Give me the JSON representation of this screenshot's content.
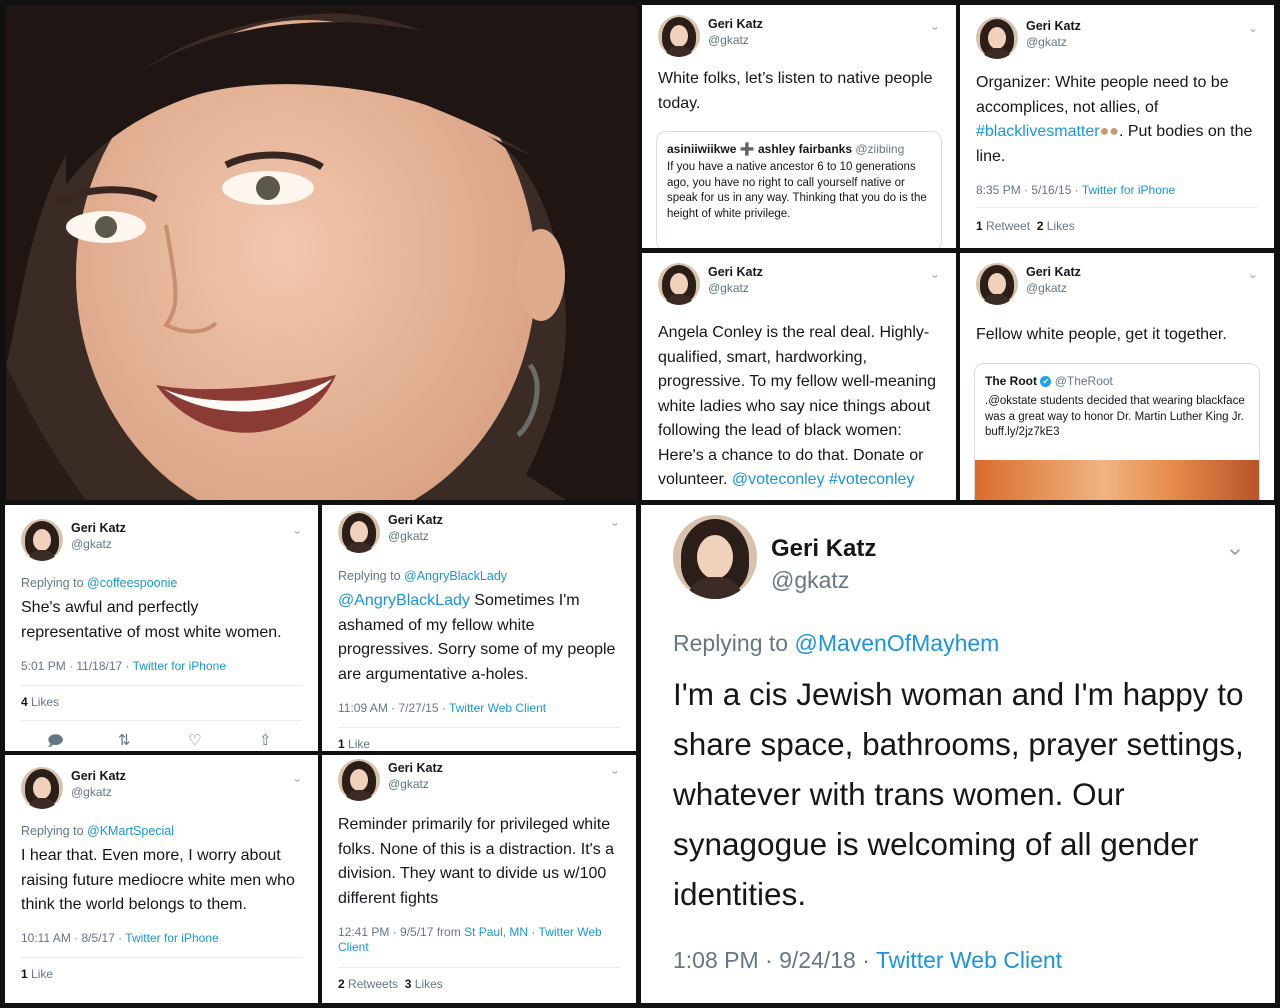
{
  "colors": {
    "link": "#1b95e0",
    "secondary": "#657786",
    "text": "#14171a",
    "background": "#111111"
  },
  "profile": {
    "name": "Geri Katz",
    "handle": "@gkatz"
  },
  "icons": {
    "menu": "chevron-down-icon",
    "reply": "reply-icon",
    "retweet": "retweet-icon",
    "like": "heart-icon",
    "share": "share-icon"
  },
  "tweets": [
    {
      "text": "White folks, let’s listen to native people today.",
      "quote": {
        "author": "asiniiwiikwe ➕ ashley fairbanks",
        "handle": "@ziibiing",
        "text": "If you have a native ancestor 6 to 10 generations ago, you have no right to call yourself native or speak for us in any way. Thinking that you do is the height of white privilege."
      }
    },
    {
      "text_main": "Organizer: White people need to be accomplices, not allies, of ",
      "hashtag": "#blacklivesmatter",
      "text_after": ". Put bodies on the line.",
      "time": "8:35 PM · 5/16/15 · ",
      "client": "Twitter for iPhone",
      "retweets": "1",
      "retweets_label": "Retweet",
      "likes": "2",
      "likes_label": "Likes"
    },
    {
      "text_main": "Angela Conley is the real deal. Highly-qualified, smart, hardworking, progressive. To my fellow well-meaning white ladies who say nice things about following the lead of black women: Here's a chance to do that. Donate or volunteer. ",
      "mention": "@voteconley",
      "hashtag": "#voteconley"
    },
    {
      "text": "Fellow white people, get it together.",
      "quote": {
        "author": "The Root",
        "verified": "✔",
        "handle": "@TheRoot",
        "text": ".@okstate students decided that wearing blackface was a great way to honor Dr. Martin Luther King Jr. buff.ly/2jz7kE3"
      }
    },
    {
      "replying_label": "Replying to ",
      "replying_to": "@coffeespoonie",
      "text": "She's awful and perfectly representative of most white women.",
      "time": "5:01 PM · 11/18/17 · ",
      "client": "Twitter for iPhone",
      "likes": "4",
      "likes_label": "Likes"
    },
    {
      "replying_label": "Replying to ",
      "replying_to": "@AngryBlackLady",
      "mention": "@AngryBlackLady",
      "text_main": " Sometimes I'm ashamed of my fellow white progressives. Sorry some of my people are argumentative a-holes.",
      "time": "11:09 AM · 7/27/15 · ",
      "client": "Twitter Web Client",
      "likes": "1",
      "likes_label": "Like"
    },
    {
      "replying_label": "Replying to ",
      "replying_to": "@MavenOfMayhem",
      "text": "I'm a cis Jewish woman and I'm happy to share space, bathrooms, prayer settings, whatever with trans women. Our synagogue is welcoming of all gender identities.",
      "time": "1:08 PM · 9/24/18 · ",
      "client": "Twitter Web Client"
    },
    {
      "replying_label": "Replying to ",
      "replying_to": "@KMartSpecial",
      "text": "I hear that. Even more, I worry about raising future mediocre white men who think the world belongs to them.",
      "time": "10:11 AM · 8/5/17 · ",
      "client": "Twitter for iPhone",
      "likes": "1",
      "likes_label": "Like"
    },
    {
      "text": "Reminder primarily for privileged white folks. None of this is a distraction. It's a division. They want to divide us w/100 different fights",
      "time": "12:41 PM · 9/5/17 from ",
      "place": "St Paul, MN",
      "sep": " · ",
      "client": "Twitter Web Client",
      "retweets": "2",
      "retweets_label": "Retweets",
      "likes": "3",
      "likes_label": "Likes"
    }
  ]
}
